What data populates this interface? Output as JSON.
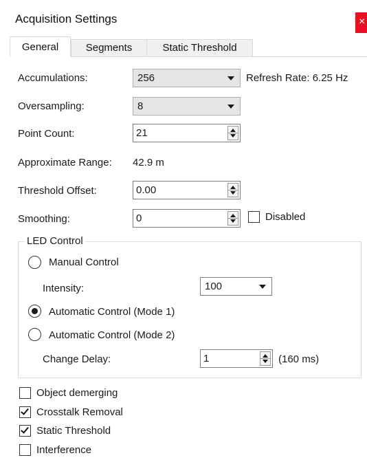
{
  "window": {
    "title": "Acquisition Settings",
    "close_glyph": "×"
  },
  "tabs": [
    {
      "label": "General",
      "active": true
    },
    {
      "label": "Segments",
      "active": false
    },
    {
      "label": "Static Threshold",
      "active": false
    }
  ],
  "general": {
    "accumulations": {
      "label": "Accumulations:",
      "value": "256"
    },
    "refresh_rate": "Refresh Rate: 6.25 Hz",
    "oversampling": {
      "label": "Oversampling:",
      "value": "8"
    },
    "point_count": {
      "label": "Point Count:",
      "value": "21"
    },
    "approximate_range": {
      "label": "Approximate Range:",
      "value": "42.9 m"
    },
    "threshold_offset": {
      "label": "Threshold Offset:",
      "value": "0.00"
    },
    "smoothing": {
      "label": "Smoothing:",
      "value": "0",
      "disabled_label": "Disabled",
      "disabled_checked": false
    }
  },
  "led_control": {
    "title": "LED Control",
    "manual": {
      "label": "Manual Control",
      "selected": false
    },
    "intensity": {
      "label": "Intensity:",
      "value": "100"
    },
    "auto_mode1": {
      "label": "Automatic Control (Mode 1)",
      "selected": true
    },
    "auto_mode2": {
      "label": "Automatic Control (Mode 2)",
      "selected": false
    },
    "change_delay": {
      "label": "Change Delay:",
      "value": "1",
      "suffix": "(160 ms)"
    }
  },
  "options": [
    {
      "label": "Object demerging",
      "checked": false
    },
    {
      "label": "Crosstalk Removal",
      "checked": true
    },
    {
      "label": "Static Threshold",
      "checked": true
    },
    {
      "label": "Interference",
      "checked": false
    }
  ],
  "colors": {
    "close_button": "#e81123",
    "combo_bg": "#e5e5e5",
    "border": "#7a7a7a"
  }
}
